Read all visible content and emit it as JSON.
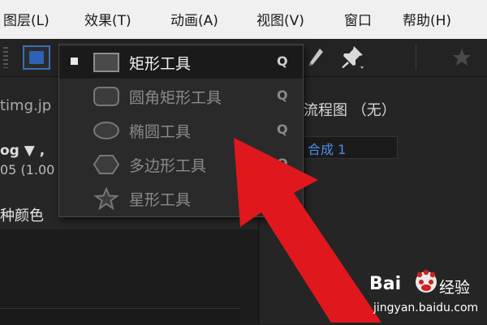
{
  "menubar": {
    "items": [
      "图层(L)",
      "效果(T)",
      "动画(A)",
      "视图(V)",
      "窗口",
      "帮助(H)"
    ]
  },
  "dropdown": {
    "items": [
      {
        "label": "矩形工具",
        "shortcut": "Q",
        "selected": true,
        "icon": "rectangle-icon"
      },
      {
        "label": "圆角矩形工具",
        "shortcut": "Q",
        "selected": false,
        "icon": "rounded-rectangle-icon"
      },
      {
        "label": "椭圆工具",
        "shortcut": "Q",
        "selected": false,
        "icon": "ellipse-icon"
      },
      {
        "label": "多边形工具",
        "shortcut": "Q",
        "selected": false,
        "icon": "polygon-icon"
      },
      {
        "label": "星形工具",
        "shortcut": "",
        "selected": false,
        "icon": "star-icon"
      }
    ]
  },
  "left_panel": {
    "filename": "timg.jp",
    "format": "og ▼ ,",
    "size": "05 (1.00",
    "colors": "种颜色"
  },
  "right_panel": {
    "flowchart": "流程图 （无）",
    "composition": "合成 1"
  },
  "watermark": {
    "brand_left": "Bai",
    "brand_right": "经验",
    "url": "jingyan.baidu.com"
  },
  "colors": {
    "menubar_bg": "#f0f0f0",
    "panel_bg": "#252525",
    "accent_blue": "#2f62b5",
    "arrow_red": "#e0171d"
  }
}
